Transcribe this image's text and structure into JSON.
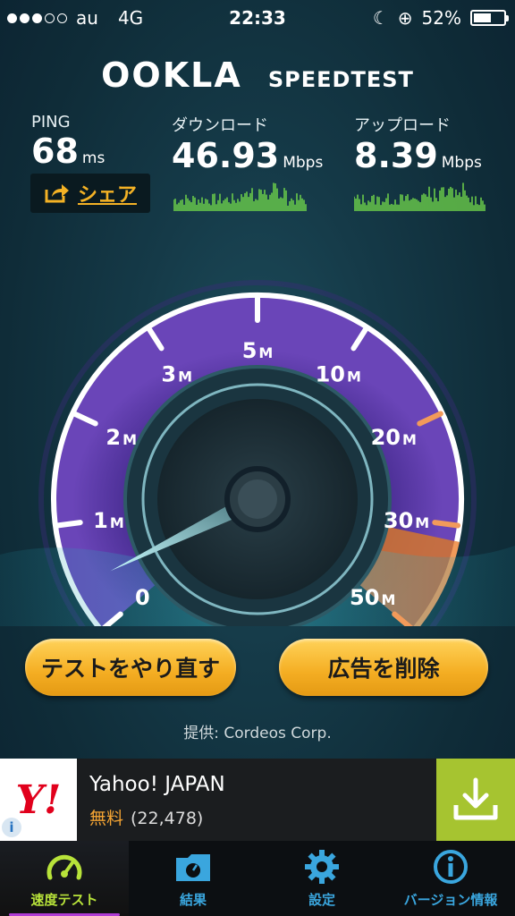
{
  "status_bar": {
    "carrier": "au",
    "network": "4G",
    "time": "22:33",
    "battery": "52%"
  },
  "logo": {
    "brand": "OOKLA",
    "product": "SPEEDTEST"
  },
  "metrics": {
    "ping": {
      "label": "PING",
      "value": "68",
      "unit": "ms"
    },
    "download": {
      "label": "ダウンロード",
      "value": "46.93",
      "unit": "Mbps"
    },
    "upload": {
      "label": "アップロード",
      "value": "8.39",
      "unit": "Mbps"
    }
  },
  "share": {
    "label": "シェア"
  },
  "gauge": {
    "ticks": [
      {
        "num": "0",
        "unit": ""
      },
      {
        "num": "1",
        "unit": "M"
      },
      {
        "num": "2",
        "unit": "M"
      },
      {
        "num": "3",
        "unit": "M"
      },
      {
        "num": "5",
        "unit": "M"
      },
      {
        "num": "10",
        "unit": "M"
      },
      {
        "num": "20",
        "unit": "M"
      },
      {
        "num": "30",
        "unit": "M"
      },
      {
        "num": "50",
        "unit": "M"
      }
    ]
  },
  "buttons": {
    "retry": "テストをやり直す",
    "remove_ads": "広告を削除"
  },
  "provider": "提供: Cordeos Corp.",
  "ad": {
    "logo": "Y!",
    "name": "Yahoo! JAPAN",
    "price": "無料",
    "count": "(22,478)",
    "info": "i"
  },
  "tabs": [
    {
      "label": "速度テスト",
      "icon": "speedometer-icon",
      "active": true
    },
    {
      "label": "結果",
      "icon": "folder-icon",
      "active": false
    },
    {
      "label": "設定",
      "icon": "gear-icon",
      "active": false
    },
    {
      "label": "バージョン情報",
      "icon": "info-icon",
      "active": false
    }
  ],
  "colors": {
    "accent": "#f4b225",
    "tab_active": "#b8e33a",
    "tab_inactive": "#3aa6de",
    "gauge_arc": "#5b3aa0"
  }
}
